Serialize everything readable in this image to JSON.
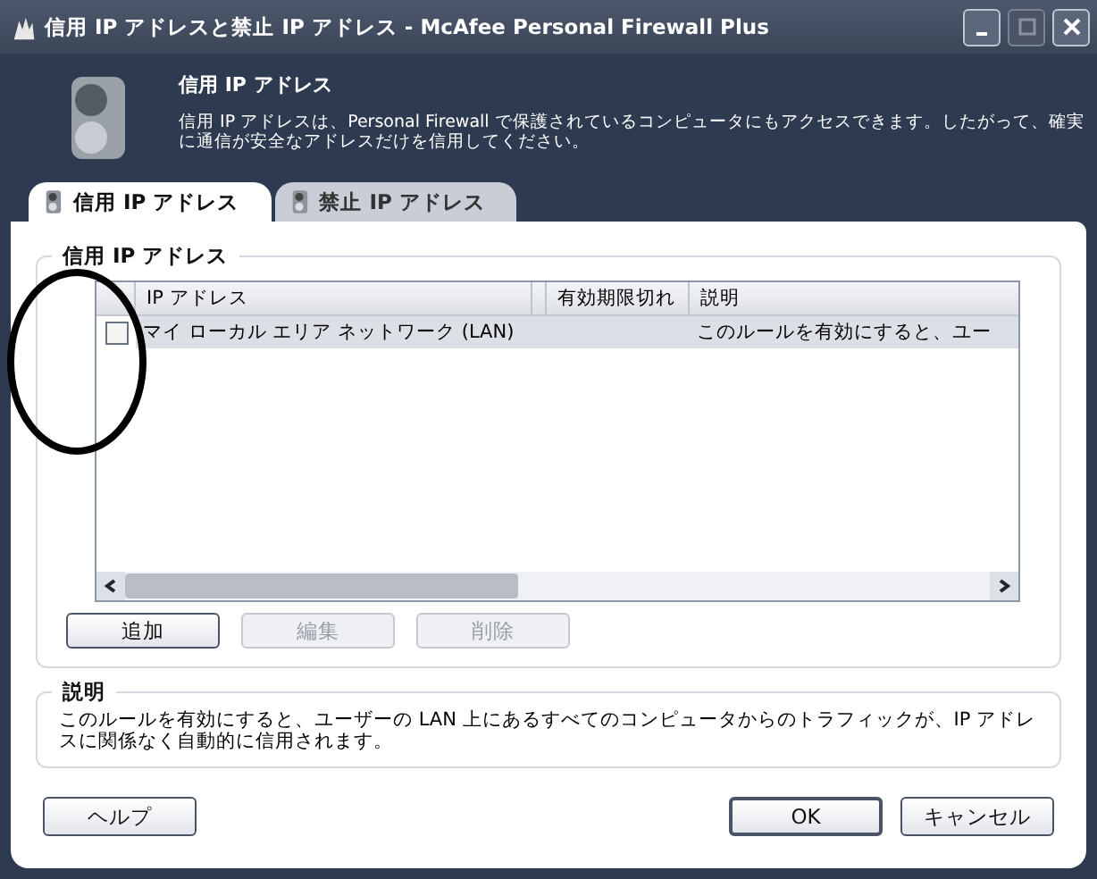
{
  "window": {
    "title": "信用 IP アドレスと禁止 IP アドレス - McAfee Personal Firewall Plus"
  },
  "header": {
    "title": "信用 IP アドレス",
    "description": "信用 IP アドレスは、Personal Firewall で保護されているコンピュータにもアクセスできます。したがって、確実に通信が安全なアドレスだけを信用してください。"
  },
  "tabs": [
    {
      "label": "信用 IP アドレス",
      "selected": true
    },
    {
      "label": "禁止 IP アドレス",
      "selected": false
    }
  ],
  "trusted_group": {
    "title": "信用 IP アドレス",
    "columns": [
      "IP アドレス",
      "有効期限切れ",
      "説明"
    ],
    "rows": [
      {
        "checked": false,
        "selected": true,
        "ip": "マイ ローカル エリア ネットワーク (LAN)",
        "description": "このルールを有効にすると、ユー"
      }
    ],
    "buttons": [
      {
        "label": "追加",
        "disabled": false
      },
      {
        "label": "編集",
        "disabled": true
      },
      {
        "label": "削除",
        "disabled": true
      }
    ]
  },
  "description_group": {
    "title": "説明",
    "text": "このルールを有効にすると、ユーザーの LAN 上にあるすべてのコンピュータからのトラフィックが、IP アドレスに関係なく自動的に信用されます。"
  },
  "footer_buttons": [
    {
      "label": "ヘルプ",
      "default": false
    },
    {
      "label": "OK",
      "default": true
    },
    {
      "label": "キャンセル",
      "default": false
    }
  ]
}
